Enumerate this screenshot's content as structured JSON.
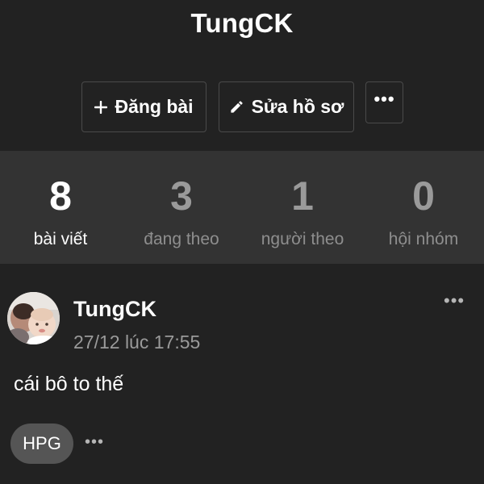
{
  "profile": {
    "name": "TungCK"
  },
  "actions": {
    "post_label": "Đăng bài",
    "post_icon": "plus-icon",
    "edit_label": "Sửa hồ sơ",
    "edit_icon": "pencil-icon",
    "more_icon": "more-horizontal-icon",
    "more_text": "•••"
  },
  "stats": [
    {
      "value": "8",
      "label": "bài viết",
      "active": true
    },
    {
      "value": "3",
      "label": "đang theo",
      "active": false
    },
    {
      "value": "1",
      "label": "người theo",
      "active": false
    },
    {
      "value": "0",
      "label": "hội nhóm",
      "active": false
    }
  ],
  "post": {
    "author": "TungCK",
    "time": "27/12 lúc 17:55",
    "text": "cái bô to thế",
    "tag": "HPG",
    "more_text": "•••",
    "tag_more_text": "•••",
    "avatar": "baby-photo-avatar"
  },
  "colors": {
    "background": "#222222",
    "stats_band": "#333333",
    "tag_background": "#555555",
    "muted_text": "#9a9a9a"
  }
}
